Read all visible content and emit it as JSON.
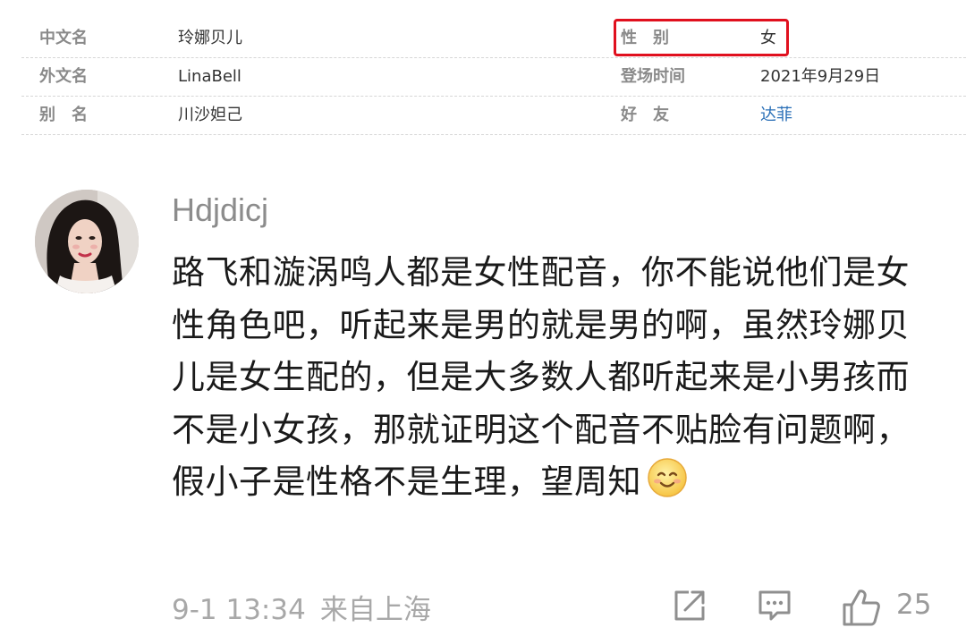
{
  "info_table": {
    "rows": [
      {
        "left_label": "中文名",
        "left_value": "玲娜贝儿",
        "right_label": "性　别",
        "right_value": "女"
      },
      {
        "left_label": "外文名",
        "left_value": "LinaBell",
        "right_label": "登场时间",
        "right_value": "2021年9月29日"
      },
      {
        "left_label": "别　名",
        "left_value": "川沙妲己",
        "right_label": "好　友",
        "right_value": "达菲"
      }
    ]
  },
  "comment": {
    "username": "Hdjdicj",
    "text": "路飞和漩涡鸣人都是女性配音，你不能说他们是女性角色吧，听起来是男的就是男的啊，虽然玲娜贝儿是女生配的，但是大多数人都听起来是小男孩而不是小女孩，那就证明这个配音不贴脸有问题啊，假小子是性格不是生理，望周知",
    "emoji": "smiling-face",
    "date": "9-1 13:34",
    "source": "来自上海",
    "like_count": "25"
  },
  "colors": {
    "highlight_border": "#e0101e",
    "link": "#2a6fb7",
    "label": "#8a8a8a",
    "meta": "#a8a8a8"
  },
  "icons": [
    "share-icon",
    "comment-icon",
    "like-icon"
  ]
}
